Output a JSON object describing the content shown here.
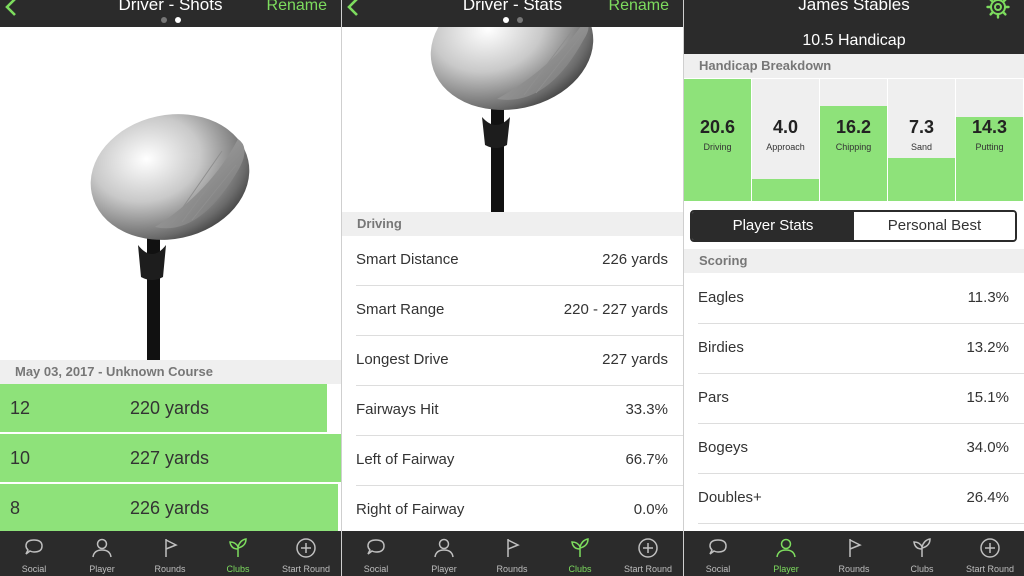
{
  "colors": {
    "accent": "#7ddc5e",
    "bar": "#8ee27a",
    "dark": "#2b2b2b",
    "header_bg": "#efefef"
  },
  "tabs": [
    "Social",
    "Player",
    "Rounds",
    "Clubs",
    "Start Round"
  ],
  "panel1": {
    "title": "Driver - Shots",
    "action": "Rename",
    "page_count": 2,
    "active_page": 2,
    "section": "May 03, 2017 - Unknown Course",
    "shots": [
      {
        "num": "12",
        "dist": "220 yards",
        "fill_pct": 96
      },
      {
        "num": "10",
        "dist": "227 yards",
        "fill_pct": 100
      },
      {
        "num": "8",
        "dist": "226 yards",
        "fill_pct": 99
      }
    ],
    "active_tab": "Clubs"
  },
  "panel2": {
    "title": "Driver - Stats",
    "action": "Rename",
    "page_count": 2,
    "active_page": 1,
    "section": "Driving",
    "stats": [
      {
        "label": "Smart Distance",
        "value": "226 yards"
      },
      {
        "label": "Smart Range",
        "value": "220 - 227 yards"
      },
      {
        "label": "Longest Drive",
        "value": "227 yards"
      },
      {
        "label": "Fairways Hit",
        "value": "33.3%"
      },
      {
        "label": "Left of Fairway",
        "value": "66.7%"
      },
      {
        "label": "Right of Fairway",
        "value": "0.0%"
      }
    ],
    "active_tab": "Clubs"
  },
  "panel3": {
    "title": "James Stables",
    "settings_icon": "gear-icon",
    "handicap": "10.5 Handicap",
    "breakdown_title": "Handicap Breakdown",
    "breakdown": [
      {
        "value": "20.6",
        "label": "Driving",
        "fill_pct": 100
      },
      {
        "value": "4.0",
        "label": "Approach",
        "fill_pct": 18
      },
      {
        "value": "16.2",
        "label": "Chipping",
        "fill_pct": 78
      },
      {
        "value": "7.3",
        "label": "Sand",
        "fill_pct": 35
      },
      {
        "value": "14.3",
        "label": "Putting",
        "fill_pct": 69
      }
    ],
    "segment": {
      "left": "Player Stats",
      "right": "Personal Best",
      "selected": "Player Stats"
    },
    "section": "Scoring",
    "stats": [
      {
        "label": "Eagles",
        "value": "11.3%"
      },
      {
        "label": "Birdies",
        "value": "13.2%"
      },
      {
        "label": "Pars",
        "value": "15.1%"
      },
      {
        "label": "Bogeys",
        "value": "34.0%"
      },
      {
        "label": "Doubles+",
        "value": "26.4%"
      }
    ],
    "active_tab": "Player"
  }
}
